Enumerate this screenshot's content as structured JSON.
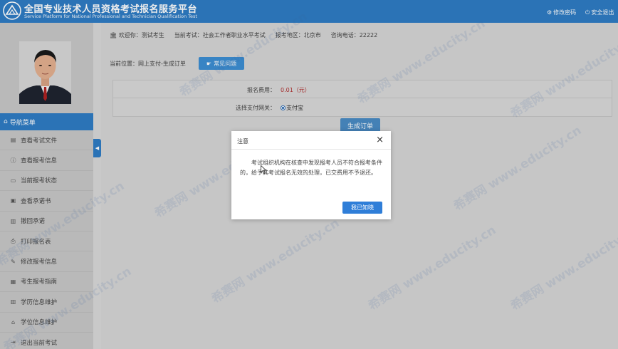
{
  "header": {
    "title": "全国专业技术人员资格考试报名服务平台",
    "subtitle": "Service Platform for National Professional and Technician Qualification Test",
    "change_password": "修改密码",
    "safe_logout": "安全退出"
  },
  "sidebar": {
    "nav_title": "导航菜单",
    "items": [
      {
        "label": "查看考试文件",
        "icon": "file-icon"
      },
      {
        "label": "查看报考信息",
        "icon": "info-icon"
      },
      {
        "label": "当前报考状态",
        "icon": "monitor-icon"
      },
      {
        "label": "查看承诺书",
        "icon": "document-icon"
      },
      {
        "label": "撤回承诺",
        "icon": "book-icon"
      },
      {
        "label": "打印报名表",
        "icon": "printer-icon"
      },
      {
        "label": "修改报考信息",
        "icon": "edit-icon"
      },
      {
        "label": "考生报考指南",
        "icon": "guide-icon"
      },
      {
        "label": "学历信息维护",
        "icon": "book-icon"
      },
      {
        "label": "学位信息维护",
        "icon": "graduation-cap-icon"
      },
      {
        "label": "退出当前考试",
        "icon": "exit-icon"
      }
    ]
  },
  "infobar": {
    "welcome": "欢迎你：",
    "user": "测试考生",
    "exam_label": "当前考试：",
    "exam": "社会工作者职业水平考试",
    "region_label": "报考地区：",
    "region": "北京市",
    "phone_label": "咨询电话：",
    "phone": "22222"
  },
  "breadcrumb": "当前位置：网上支付-生成订单",
  "faq_button": "常见问题",
  "form": {
    "fee_label": "报名费用：",
    "fee_value": "0.01（元）",
    "gateway_label": "选择支付网关：",
    "gateway_option": "支付宝"
  },
  "order_button": "生成订单",
  "dialog": {
    "title": "注意",
    "body": "考试组织机构在核查中发现报考人员不符合报考条件的，给予其考试报名无效的处理，已交费用不予退还。",
    "confirm": "我已知晓"
  },
  "watermark": "希赛网 www.educity.cn"
}
